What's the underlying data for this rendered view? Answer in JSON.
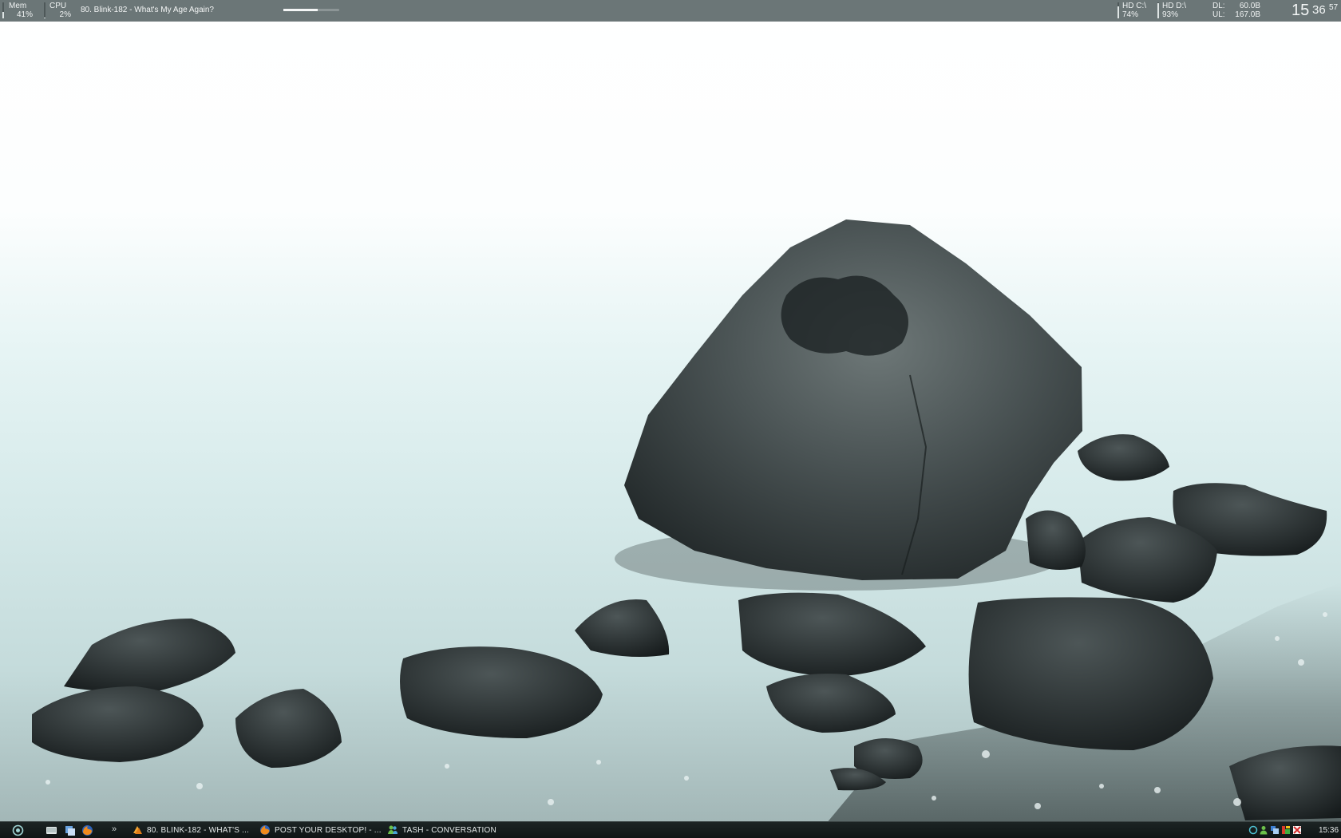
{
  "topbar": {
    "mem": {
      "label": "Mem",
      "value": "41%",
      "level": 0.41
    },
    "cpu": {
      "label": "CPU",
      "value": "2%",
      "level": 0.02
    },
    "now_playing": "80. Blink-182 - What's My Age Again?",
    "progress": 0.62,
    "hd_c": {
      "label": "HD C:\\",
      "value": "74%",
      "level": 0.74
    },
    "hd_d": {
      "label": "HD D:\\",
      "value": "93%",
      "level": 0.93
    },
    "net": {
      "dl_label": "DL:",
      "dl_value": "60.0B",
      "ul_label": "UL:",
      "ul_value": "167.0B"
    },
    "clock": {
      "hours": "15",
      "minutes": "36",
      "seconds": "57"
    }
  },
  "taskbar": {
    "quicklaunch": [
      {
        "name": "start-orb-icon"
      },
      {
        "name": "show-desktop-icon"
      },
      {
        "name": "window-switcher-icon"
      },
      {
        "name": "firefox-icon"
      },
      {
        "label": "»",
        "name": "overflow-chevron"
      }
    ],
    "tasks": [
      {
        "label": "80. BLINK-182 - WHAT'S ...",
        "icon": "winamp-icon"
      },
      {
        "label": "POST YOUR DESKTOP! - ...",
        "icon": "firefox-icon"
      },
      {
        "label": "TASH - CONVERSATION",
        "icon": "messenger-icon"
      }
    ],
    "tray": [
      {
        "name": "network-icon"
      },
      {
        "name": "messenger-status-icon"
      },
      {
        "name": "display-icon"
      },
      {
        "name": "color-blocks-icon"
      },
      {
        "name": "security-icon"
      }
    ],
    "clock": "15:36"
  },
  "colors": {
    "bar": "#6b7677",
    "taskbar": "#121818",
    "water": "#d4e9e9"
  }
}
